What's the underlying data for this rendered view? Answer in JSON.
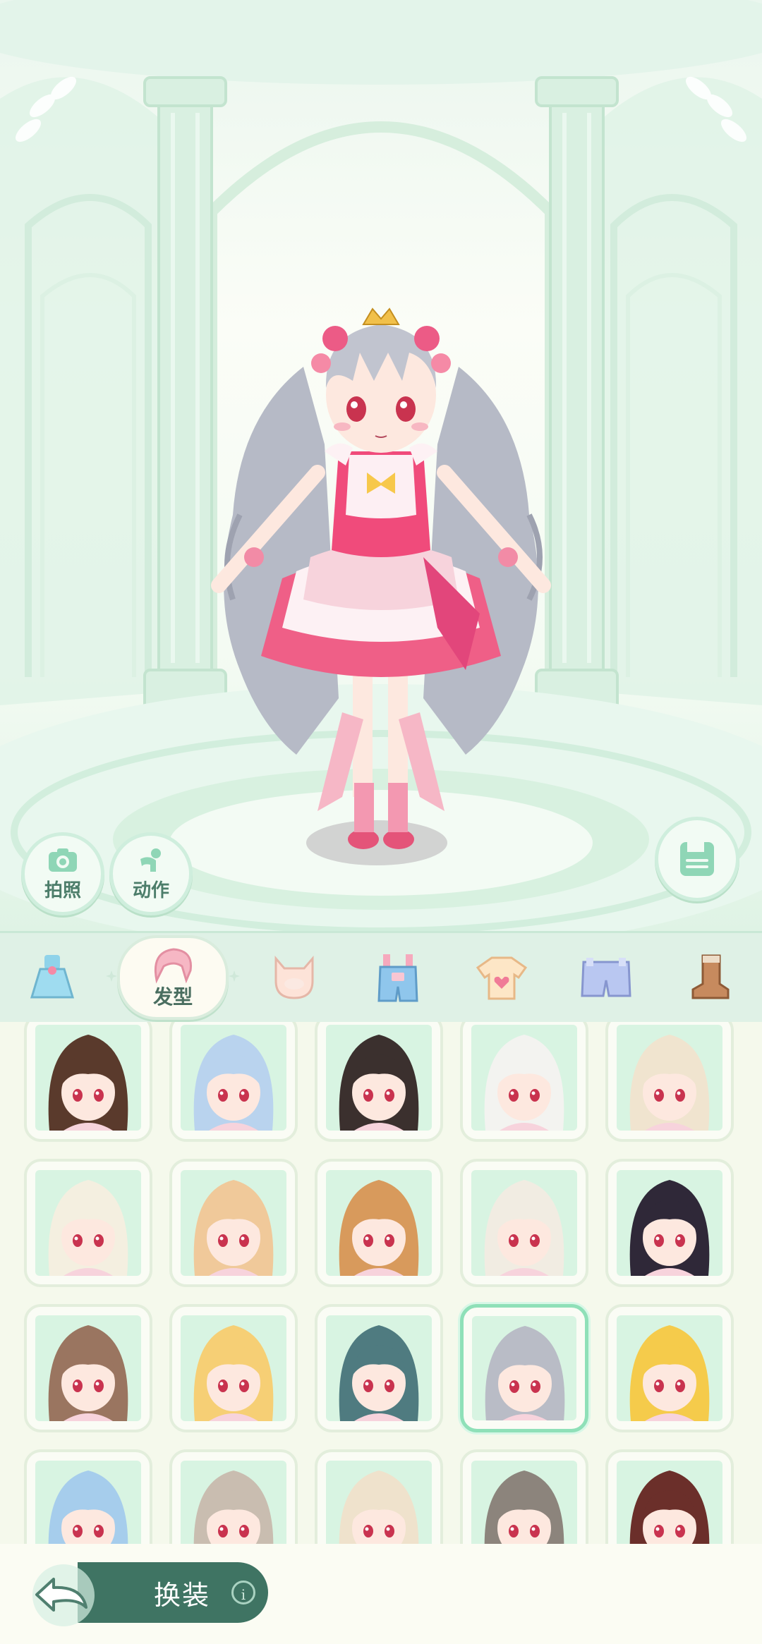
{
  "stage": {
    "photo_label": "拍照",
    "action_label": "动作",
    "save_icon": "save-icon"
  },
  "tabs": [
    {
      "id": "dress",
      "icon": "dress-icon",
      "label": ""
    },
    {
      "id": "hairstyle",
      "icon": "hair-icon",
      "label": "发型",
      "active": true
    },
    {
      "id": "face",
      "icon": "face-icon",
      "label": ""
    },
    {
      "id": "overalls",
      "icon": "overalls-icon",
      "label": ""
    },
    {
      "id": "tshirt",
      "icon": "tshirt-icon",
      "label": ""
    },
    {
      "id": "shorts",
      "icon": "shorts-icon",
      "label": ""
    },
    {
      "id": "boots",
      "icon": "boots-icon",
      "label": ""
    }
  ],
  "hair_colors": [
    "#5a3a2c",
    "#b9d3ee",
    "#3b302e",
    "#f3f3f0",
    "#f0e4cf",
    "#f4efe0",
    "#f0c99a",
    "#d89a5c",
    "#f1ece2",
    "#2f2838",
    "#9a7560",
    "#f6cf75",
    "#4f7b80",
    "#b9bcc6",
    "#f5cb4b",
    "#a6cdec",
    "#c9bdb0",
    "#efe2cc",
    "#8c847c",
    "#6b2f2a"
  ],
  "selected_index": 13,
  "bottom": {
    "back_icon": "back-arrow-icon",
    "dress_up_label": "换装",
    "info_icon": "info-icon"
  }
}
